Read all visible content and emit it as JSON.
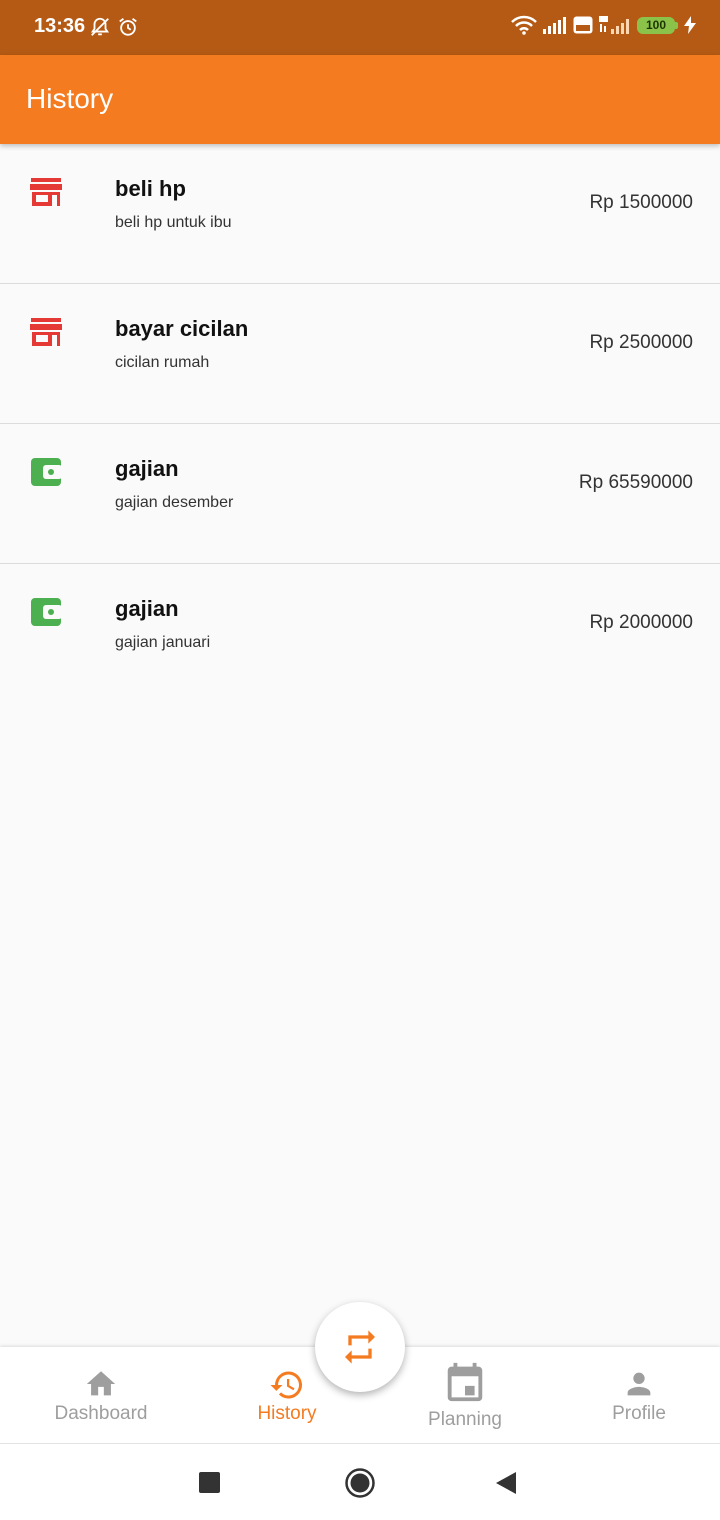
{
  "status_bar": {
    "time": "13:36",
    "battery": "100",
    "icons": [
      "mute-bell-icon",
      "alarm-icon",
      "wifi-icon",
      "signal-icon",
      "volte-icon",
      "4g-signal-icon",
      "charging-icon"
    ]
  },
  "app_bar": {
    "title": "History"
  },
  "transactions": [
    {
      "title": "beli hp",
      "subtitle": "beli hp untuk ibu",
      "amount": "Rp 1500000",
      "icon": "store-icon",
      "icon_color": "#e53935"
    },
    {
      "title": "bayar cicilan",
      "subtitle": "cicilan rumah",
      "amount": "Rp 2500000",
      "icon": "store-icon",
      "icon_color": "#e53935"
    },
    {
      "title": "gajian",
      "subtitle": "gajian desember",
      "amount": "Rp 65590000",
      "icon": "wallet-icon",
      "icon_color": "#4caf50"
    },
    {
      "title": "gajian",
      "subtitle": "gajian januari",
      "amount": "Rp 2000000",
      "icon": "wallet-icon",
      "icon_color": "#4caf50"
    }
  ],
  "bottom_nav": {
    "items": [
      {
        "label": "Dashboard",
        "icon": "home-icon",
        "active": false
      },
      {
        "label": "History",
        "icon": "history-icon",
        "active": true
      },
      {
        "label": "Planning",
        "icon": "calendar-icon",
        "active": false
      },
      {
        "label": "Profile",
        "icon": "person-icon",
        "active": false
      }
    ],
    "fab_icon": "repeat-icon"
  },
  "colors": {
    "accent": "#f47b20",
    "status_bar": "#b55a14",
    "expense_icon": "#e53935",
    "income_icon": "#4caf50",
    "inactive_nav": "#9e9e9e"
  }
}
